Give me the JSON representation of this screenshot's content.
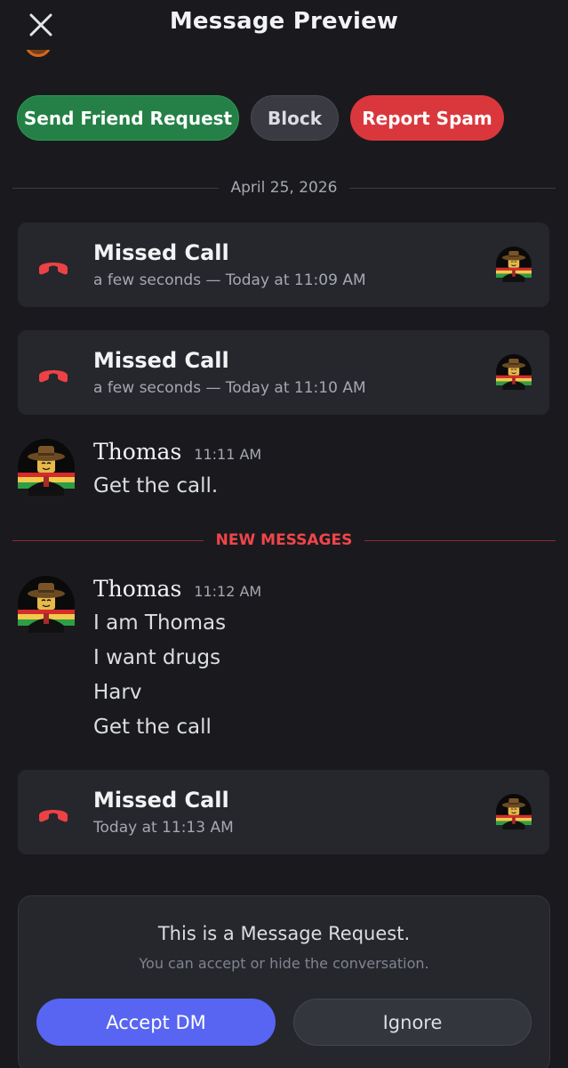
{
  "header": {
    "title": "Message Preview"
  },
  "actions": {
    "send_friend_request": "Send Friend Request",
    "block": "Block",
    "report_spam": "Report Spam"
  },
  "date_divider": "April 25, 2026",
  "calls": [
    {
      "title": "Missed Call",
      "meta": "a few seconds — Today at 11:09 AM"
    },
    {
      "title": "Missed Call",
      "meta": "a few seconds — Today at 11:10 AM"
    },
    {
      "title": "Missed Call",
      "meta": "Today at 11:13 AM"
    }
  ],
  "messages": [
    {
      "author": "Thomas",
      "time": "11:11 AM",
      "lines": [
        "Get the call."
      ]
    },
    {
      "author": "Thomas",
      "time": "11:12 AM",
      "lines": [
        "I am Thomas",
        "I want drugs",
        "Harv",
        "Get the call"
      ]
    }
  ],
  "new_messages_label": "NEW MESSAGES",
  "request": {
    "title": "This is a Message Request.",
    "subtitle": "You can accept or hide the conversation.",
    "accept": "Accept DM",
    "ignore": "Ignore"
  },
  "colors": {
    "background": "#1a1a1e",
    "card": "#26272d",
    "green": "#248046",
    "red": "#da373c",
    "blurple": "#5865f2",
    "missed_call": "#ed4245"
  },
  "icons": {
    "close": "close-icon",
    "missed_call": "phone-hangup-icon",
    "avatar": "user-avatar"
  }
}
